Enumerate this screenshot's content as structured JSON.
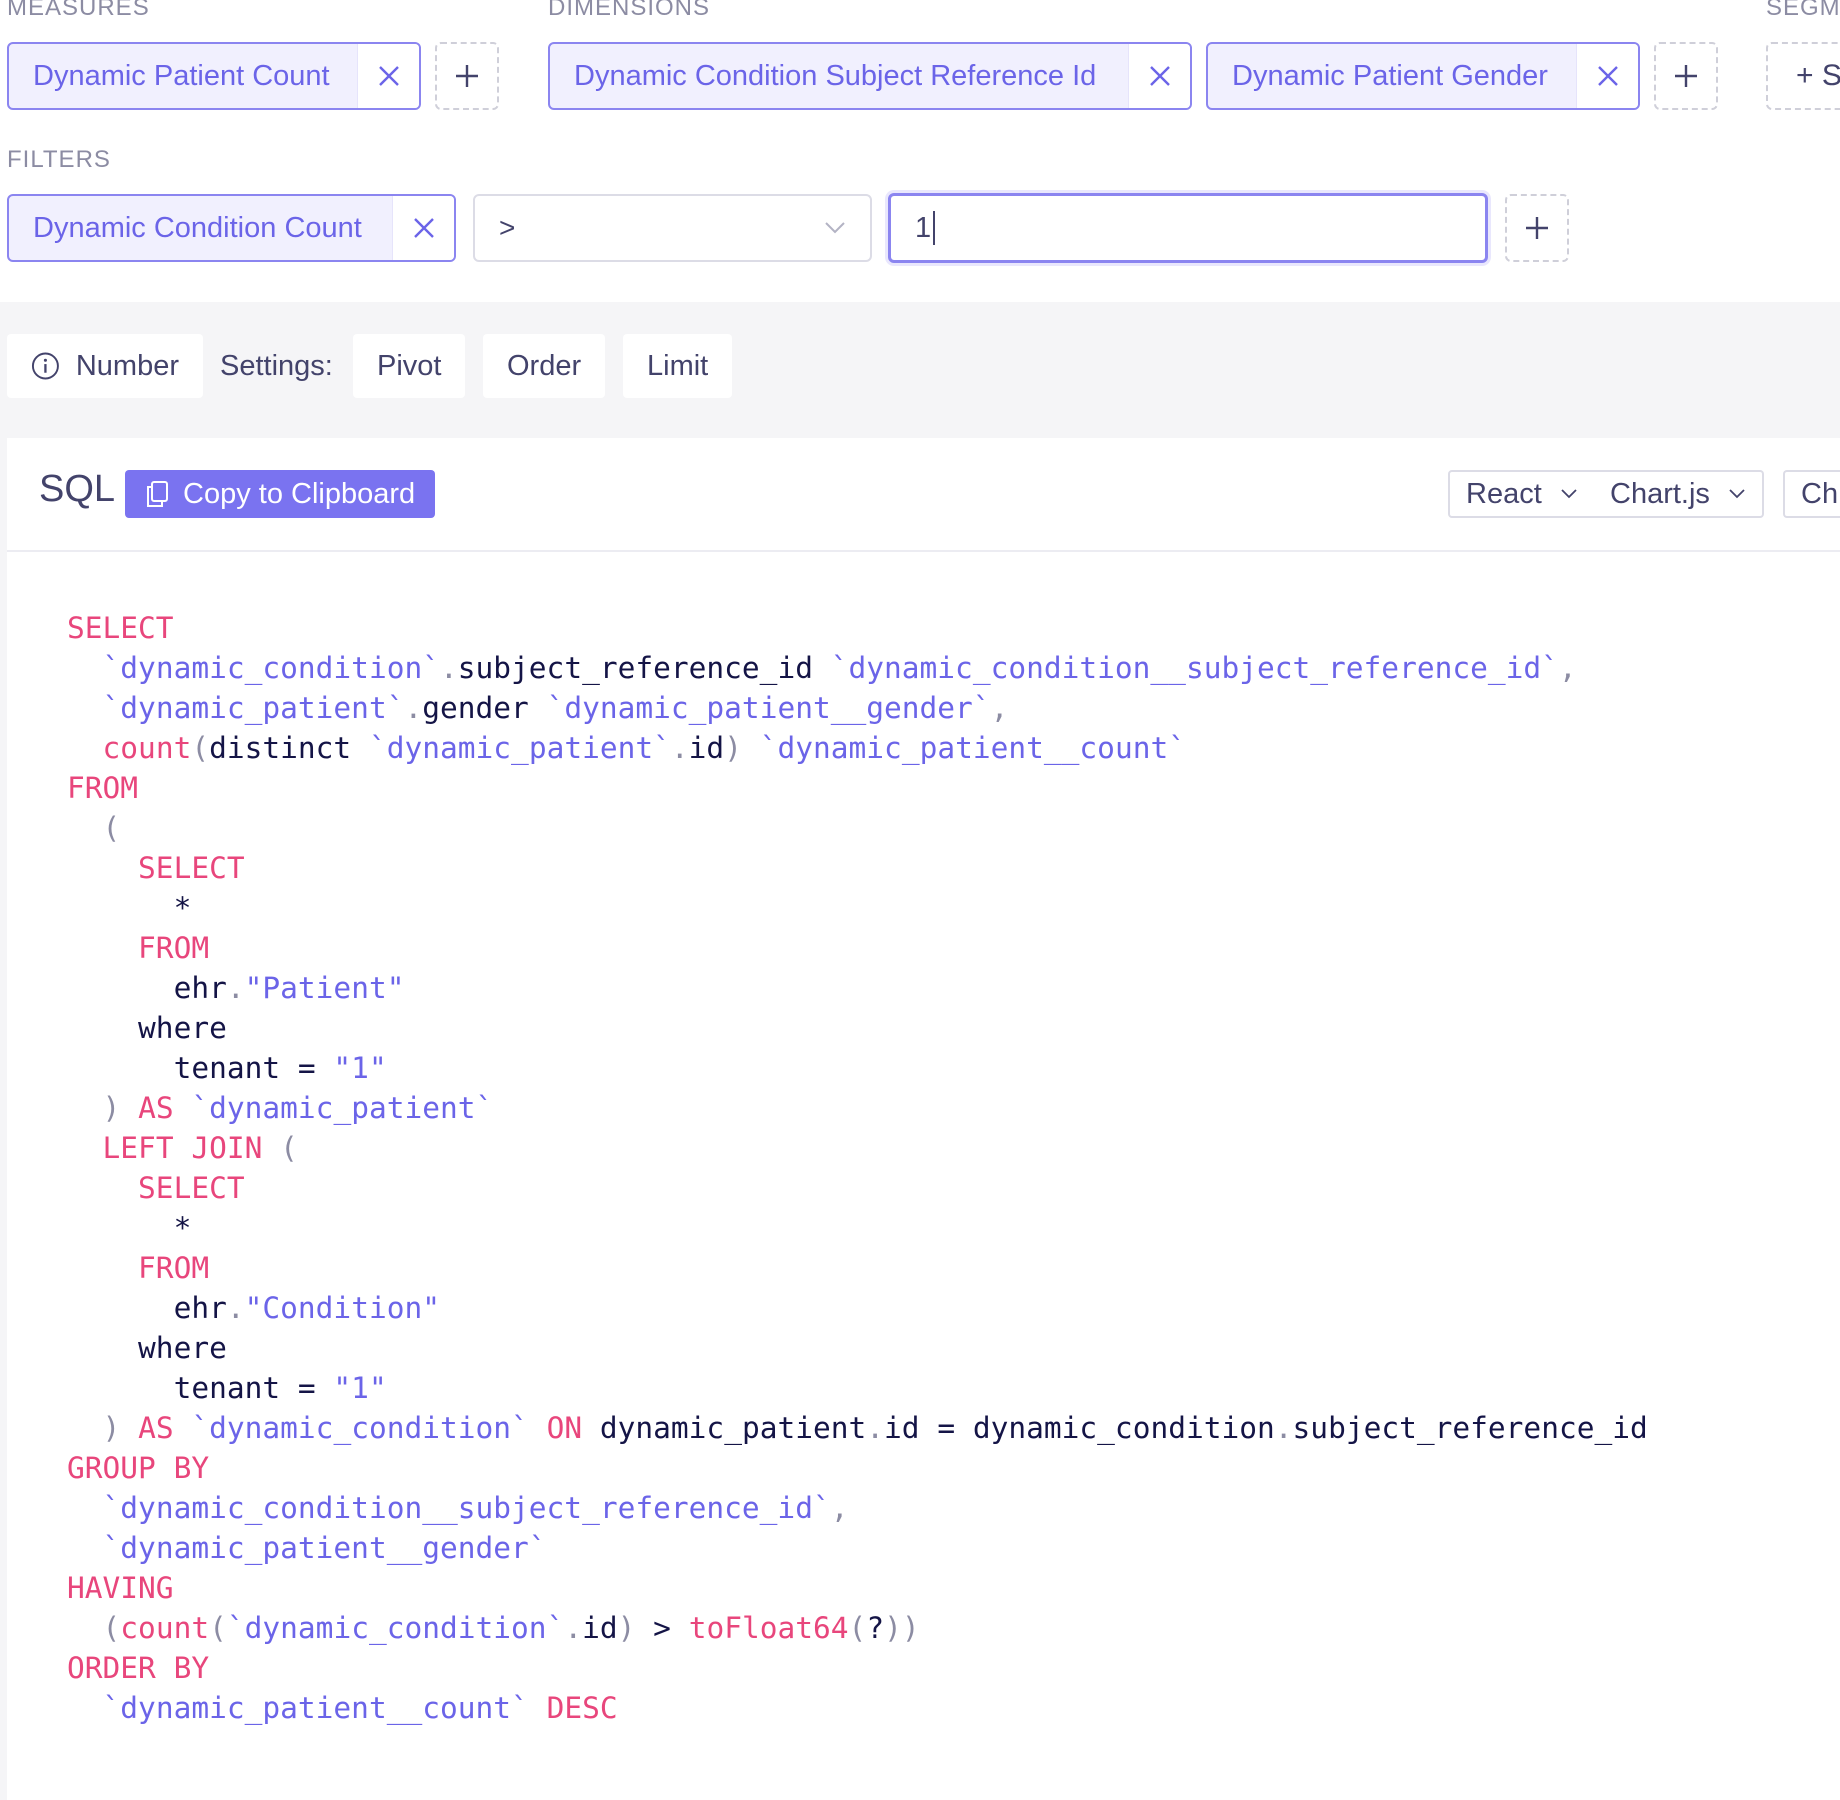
{
  "query_builder": {
    "measures_label": "MEASURES",
    "dimensions_label": "DIMENSIONS",
    "segments_label": "SEGM",
    "filters_label": "FILTERS",
    "measures": [
      "Dynamic Patient Count"
    ],
    "dimensions": [
      "Dynamic Condition Subject Reference Id",
      "Dynamic Patient Gender"
    ],
    "segments_add_label": "+ S",
    "filter": {
      "member": "Dynamic Condition Count",
      "operator": ">",
      "value": "1"
    }
  },
  "toolbar": {
    "chart_type": "Number",
    "settings_label": "Settings:",
    "buttons": [
      "Pivot",
      "Order",
      "Limit"
    ]
  },
  "panel": {
    "title": "SQL",
    "copy_label": "Copy to Clipboard",
    "framework_select": "React",
    "library_select": "Chart.js",
    "third_select": "Ch"
  },
  "sql_lines": [
    [
      [
        "kw",
        "SELECT"
      ]
    ],
    [
      [
        "pl",
        "  "
      ],
      [
        "id",
        "`dynamic_condition`"
      ],
      [
        "pu",
        "."
      ],
      [
        "pl",
        "subject_reference_id "
      ],
      [
        "id",
        "`dynamic_condition__subject_reference_id`"
      ],
      [
        "pu",
        ","
      ]
    ],
    [
      [
        "pl",
        "  "
      ],
      [
        "id",
        "`dynamic_patient`"
      ],
      [
        "pu",
        "."
      ],
      [
        "pl",
        "gender "
      ],
      [
        "id",
        "`dynamic_patient__gender`"
      ],
      [
        "pu",
        ","
      ]
    ],
    [
      [
        "pl",
        "  "
      ],
      [
        "kw",
        "count"
      ],
      [
        "pu",
        "("
      ],
      [
        "pl",
        "distinct "
      ],
      [
        "id",
        "`dynamic_patient`"
      ],
      [
        "pu",
        "."
      ],
      [
        "pl",
        "id"
      ],
      [
        "pu",
        ")"
      ],
      [
        "pl",
        " "
      ],
      [
        "id",
        "`dynamic_patient__count`"
      ]
    ],
    [
      [
        "kw",
        "FROM"
      ]
    ],
    [
      [
        "pl",
        "  "
      ],
      [
        "pu",
        "("
      ]
    ],
    [
      [
        "pl",
        "    "
      ],
      [
        "kw",
        "SELECT"
      ]
    ],
    [
      [
        "pl",
        "      *"
      ]
    ],
    [
      [
        "pl",
        "    "
      ],
      [
        "kw",
        "FROM"
      ]
    ],
    [
      [
        "pl",
        "      ehr"
      ],
      [
        "pu",
        "."
      ],
      [
        "st",
        "\"Patient\""
      ]
    ],
    [
      [
        "pl",
        "    where"
      ]
    ],
    [
      [
        "pl",
        "      tenant = "
      ],
      [
        "st",
        "\"1\""
      ]
    ],
    [
      [
        "pl",
        "  "
      ],
      [
        "pu",
        ")"
      ],
      [
        "pl",
        " "
      ],
      [
        "kw",
        "AS"
      ],
      [
        "pl",
        " "
      ],
      [
        "id",
        "`dynamic_patient`"
      ]
    ],
    [
      [
        "pl",
        "  "
      ],
      [
        "kw",
        "LEFT JOIN"
      ],
      [
        "pl",
        " "
      ],
      [
        "pu",
        "("
      ]
    ],
    [
      [
        "pl",
        "    "
      ],
      [
        "kw",
        "SELECT"
      ]
    ],
    [
      [
        "pl",
        "      *"
      ]
    ],
    [
      [
        "pl",
        "    "
      ],
      [
        "kw",
        "FROM"
      ]
    ],
    [
      [
        "pl",
        "      ehr"
      ],
      [
        "pu",
        "."
      ],
      [
        "st",
        "\"Condition\""
      ]
    ],
    [
      [
        "pl",
        "    where"
      ]
    ],
    [
      [
        "pl",
        "      tenant = "
      ],
      [
        "st",
        "\"1\""
      ]
    ],
    [
      [
        "pl",
        "  "
      ],
      [
        "pu",
        ")"
      ],
      [
        "pl",
        " "
      ],
      [
        "kw",
        "AS"
      ],
      [
        "pl",
        " "
      ],
      [
        "id",
        "`dynamic_condition`"
      ],
      [
        "pl",
        " "
      ],
      [
        "kw",
        "ON"
      ],
      [
        "pl",
        " dynamic_patient"
      ],
      [
        "pu",
        "."
      ],
      [
        "pl",
        "id = dynamic_condition"
      ],
      [
        "pu",
        "."
      ],
      [
        "pl",
        "subject_reference_id"
      ]
    ],
    [
      [
        "kw",
        "GROUP BY"
      ]
    ],
    [
      [
        "pl",
        "  "
      ],
      [
        "id",
        "`dynamic_condition__subject_reference_id`"
      ],
      [
        "pu",
        ","
      ]
    ],
    [
      [
        "pl",
        "  "
      ],
      [
        "id",
        "`dynamic_patient__gender`"
      ]
    ],
    [
      [
        "kw",
        "HAVING"
      ]
    ],
    [
      [
        "pl",
        "  "
      ],
      [
        "pu",
        "("
      ],
      [
        "kw",
        "count"
      ],
      [
        "pu",
        "("
      ],
      [
        "id",
        "`dynamic_condition`"
      ],
      [
        "pu",
        "."
      ],
      [
        "pl",
        "id"
      ],
      [
        "pu",
        ")"
      ],
      [
        "pl",
        " > "
      ],
      [
        "kw",
        "toFloat64"
      ],
      [
        "pu",
        "("
      ],
      [
        "pl",
        "?"
      ],
      [
        "pu",
        "))"
      ]
    ],
    [
      [
        "kw",
        "ORDER BY"
      ]
    ],
    [
      [
        "pl",
        "  "
      ],
      [
        "id",
        "`dynamic_patient__count`"
      ],
      [
        "pl",
        " "
      ],
      [
        "kw",
        "DESC"
      ]
    ]
  ]
}
